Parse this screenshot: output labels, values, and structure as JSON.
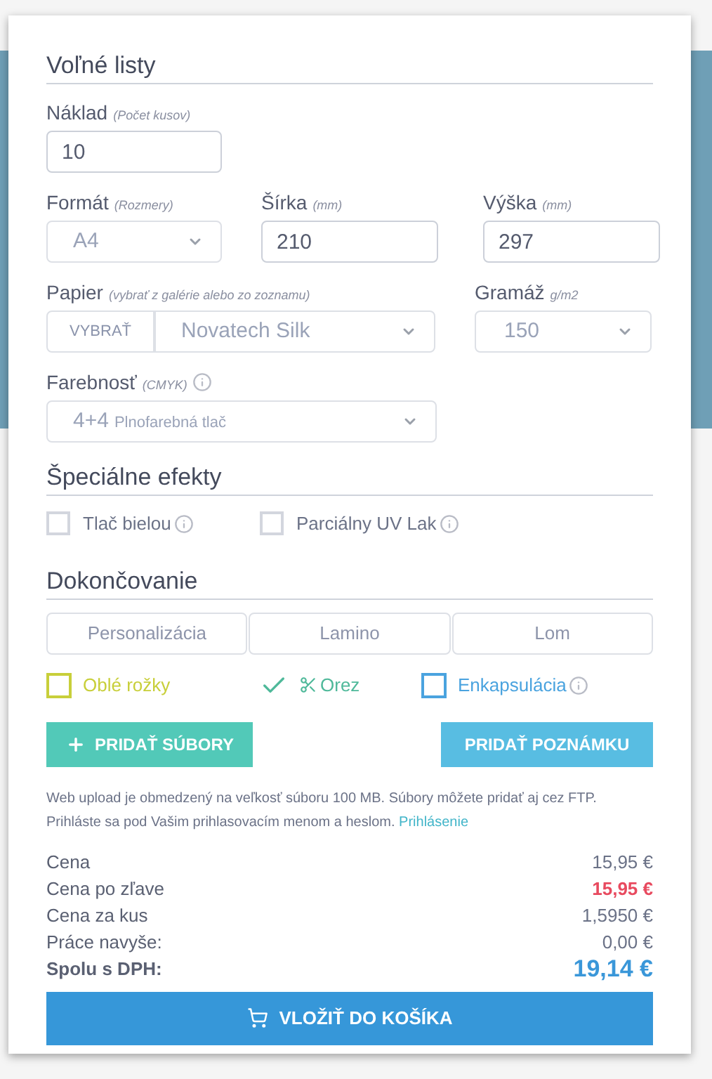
{
  "title": "Voľné listy",
  "naklad": {
    "label": "Náklad",
    "hint": "(Počet kusov)",
    "value": "10"
  },
  "format": {
    "label": "Formát",
    "hint": "(Rozmery)",
    "value": "A4"
  },
  "sirka": {
    "label": "Šírka",
    "hint": "(mm)",
    "value": "210"
  },
  "vyska": {
    "label": "Výška",
    "hint": "(mm)",
    "value": "297"
  },
  "papier": {
    "label": "Papier",
    "hint": "(vybrať z galérie alebo zo zoznamu)",
    "button": "VYBRAŤ",
    "value": "Novatech Silk"
  },
  "gramaz": {
    "label": "Gramáž",
    "hint": "g/m2",
    "value": "150"
  },
  "farebnost": {
    "label": "Farebnosť",
    "hint": "(CMYK)",
    "value": "4+4",
    "value_note": "Plnofarebná tlač"
  },
  "effects": {
    "title": "Špeciálne efekty",
    "items": [
      {
        "label": "Tlač bielou",
        "checked": false
      },
      {
        "label": "Parciálny UV Lak",
        "checked": false
      }
    ]
  },
  "finishing": {
    "title": "Dokončovanie",
    "tabs": [
      {
        "label": "Personalizácia",
        "selected": false
      },
      {
        "label": "Lamino",
        "selected": false
      },
      {
        "label": "Lom",
        "selected": false
      }
    ],
    "options": [
      {
        "label": "Oblé rožky",
        "checked": false,
        "color": "#c8cf3a",
        "info": false,
        "scissors": false
      },
      {
        "label": "Orez",
        "checked": true,
        "color": "#4fb99a",
        "info": false,
        "scissors": true
      },
      {
        "label": "Enkapsulácia",
        "checked": false,
        "color": "#4aa3df",
        "info": true,
        "scissors": false
      }
    ]
  },
  "add_files": "PRIDAŤ SÚBORY",
  "add_note": "PRIDAŤ POZNÁMKU",
  "notice": "Web upload je obmedzený na veľkosť súboru 100 MB. Súbory môžete pridať aj cez FTP. Prihláste sa pod Vašim prihlasovacím menom a heslom.",
  "notice_link": "Prihlásenie",
  "prices": [
    {
      "label": "Cena",
      "value": "15,95 €",
      "kind": "normal"
    },
    {
      "label": "Cena po zľave",
      "value": "15,95 €",
      "kind": "discount"
    },
    {
      "label": "Cena za kus",
      "value": "1,5950 €",
      "kind": "normal"
    },
    {
      "label": "Práce navyše:",
      "value": "0,00 €",
      "kind": "normal"
    },
    {
      "label": "Spolu s DPH:",
      "value": "19,14 €",
      "kind": "total"
    }
  ],
  "cart_button": "VLOŽIŤ DO KOŠÍKA"
}
